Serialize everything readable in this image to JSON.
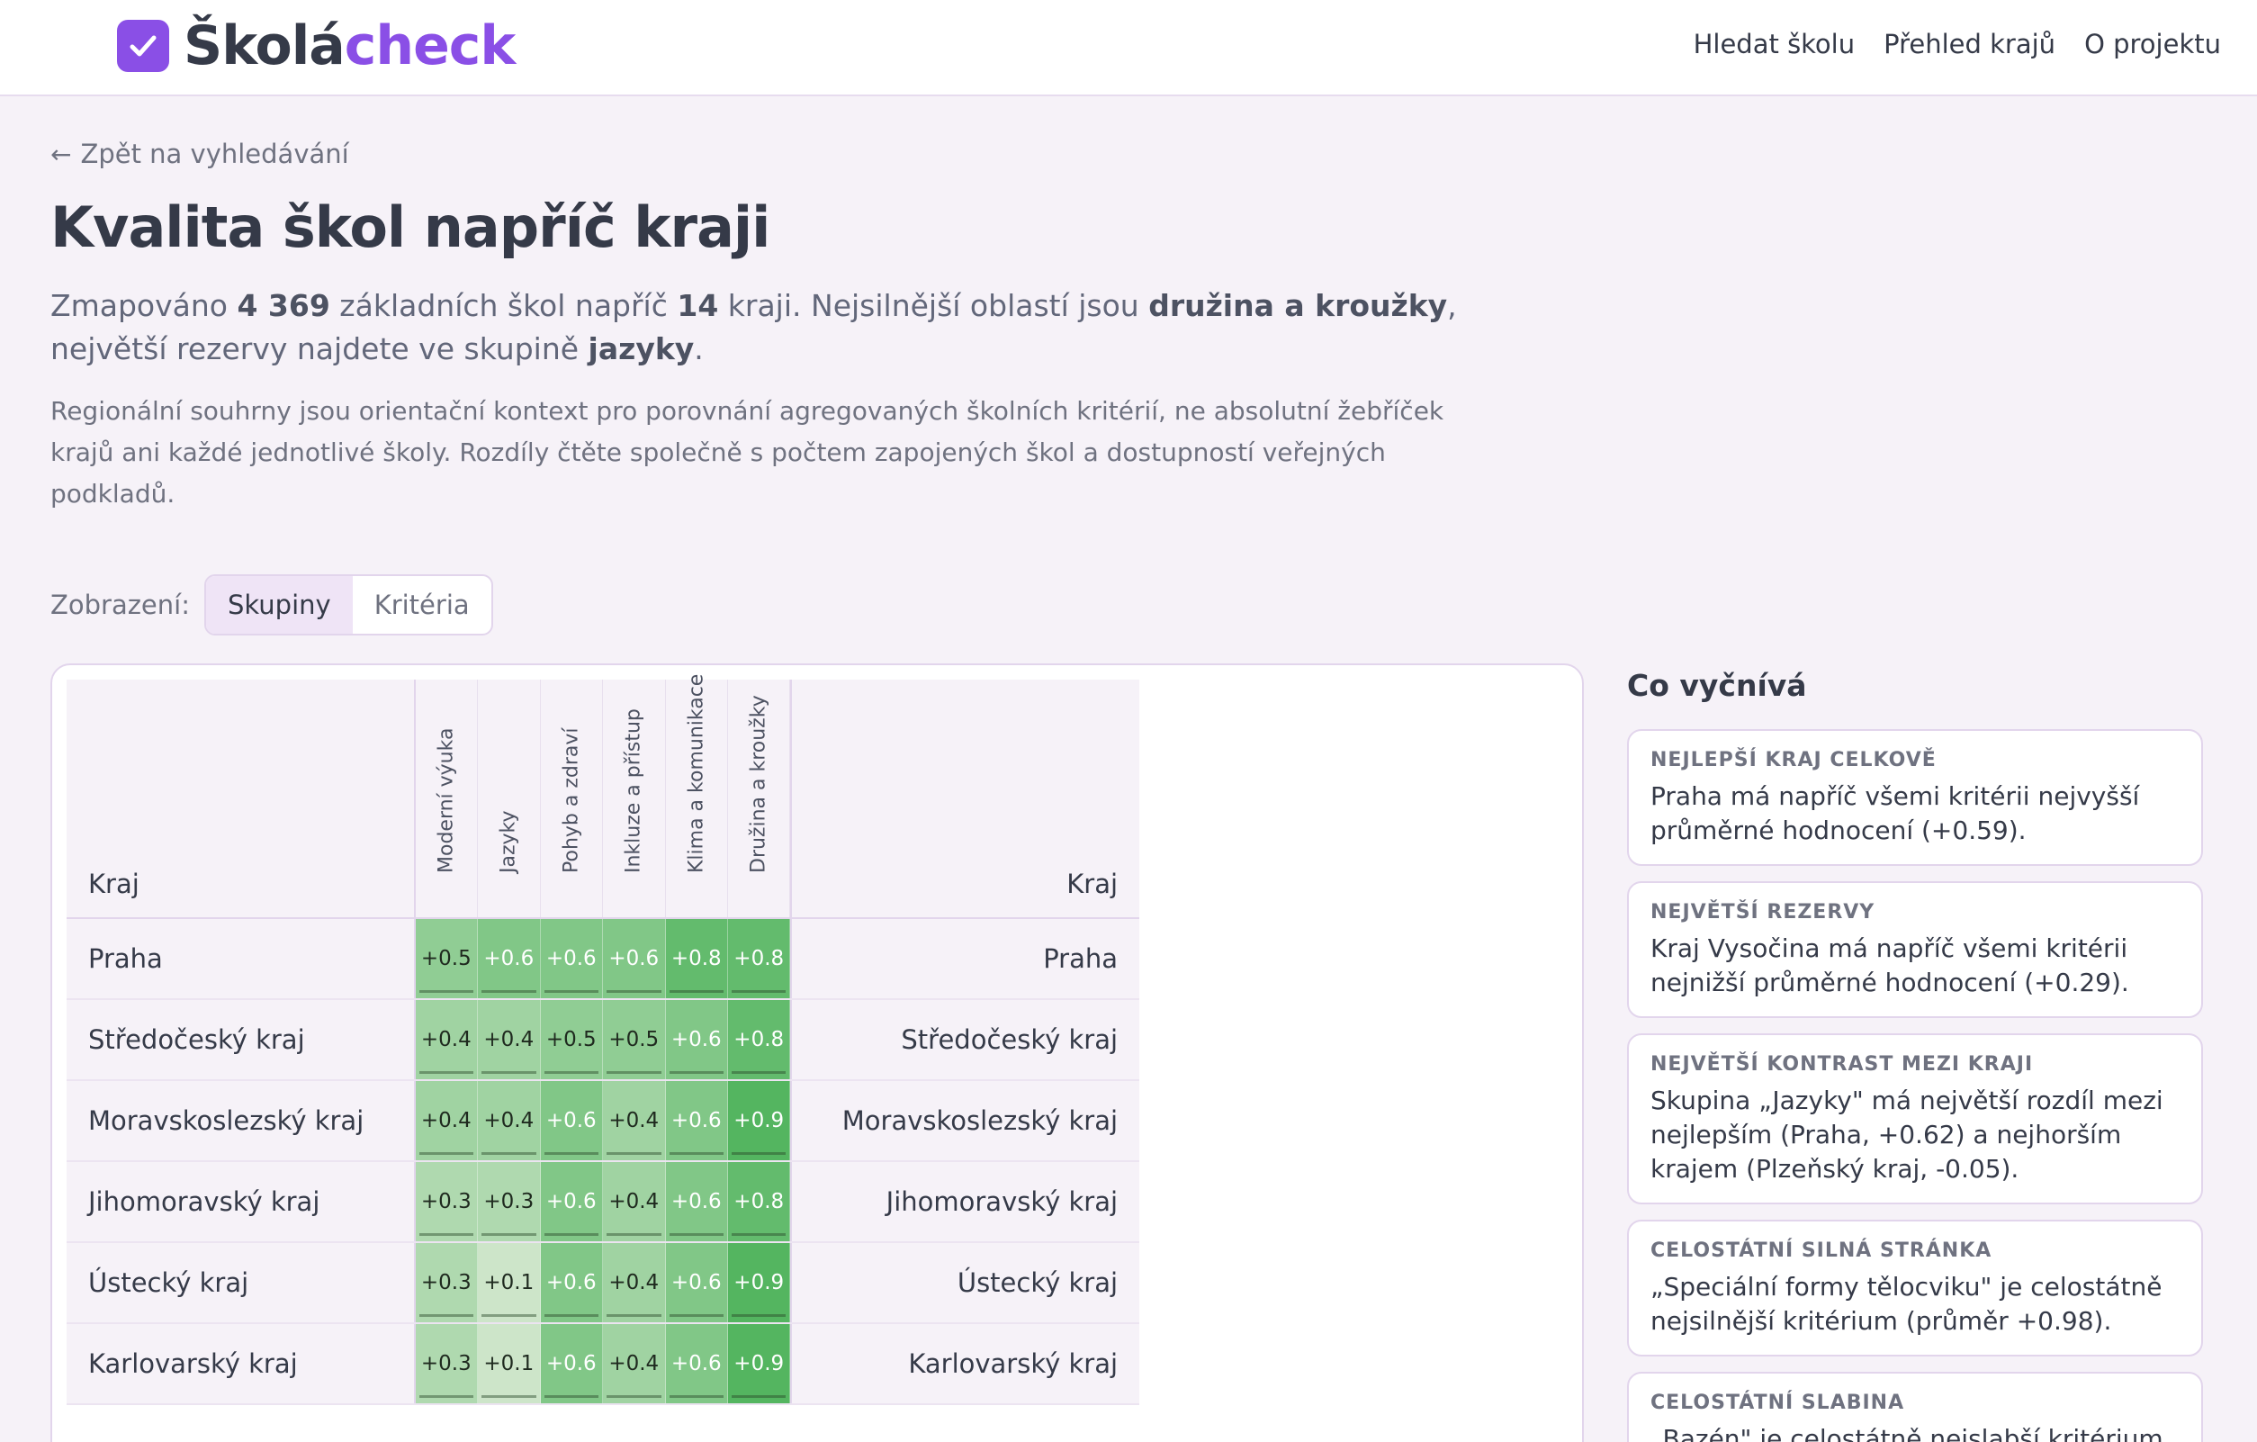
{
  "header": {
    "logo_part1": "Školá",
    "logo_part2": "check",
    "nav": [
      "Hledat školu",
      "Přehled krajů",
      "O projektu"
    ]
  },
  "back_link": "Zpět na vyhledávání",
  "title": "Kvalita škol napříč kraji",
  "lead": {
    "t1": "Zmapováno ",
    "schools": "4 369",
    "t2": " základních škol napříč ",
    "regions": "14",
    "t3": " kraji. Nejsilnější oblastí jsou ",
    "strongest": "družina a kroužky",
    "t4": ", největší rezervy najdete ve skupině ",
    "weakest": "jazyky",
    "t5": "."
  },
  "description": "Regionální souhrny jsou orientační kontext pro porovnání agregovaných školních kritérií, ne absolutní žebříček krajů ani každé jednotlivé školy. Rozdíly čtěte společně s počtem zapojených škol a dostupností veřejných podkladů.",
  "view": {
    "label": "Zobrazení:",
    "options": [
      "Skupiny",
      "Kritéria"
    ],
    "active": "Skupiny"
  },
  "table": {
    "kraj_header": "Kraj",
    "columns": [
      "Moderní výuka",
      "Jazyky",
      "Pohyb a zdraví",
      "Inkluze a přístup",
      "Klima a komunikace",
      "Družina a kroužky"
    ],
    "rows": [
      {
        "kraj": "Praha",
        "values": [
          "+0.5",
          "+0.6",
          "+0.6",
          "+0.6",
          "+0.8",
          "+0.8"
        ]
      },
      {
        "kraj": "Středočeský kraj",
        "values": [
          "+0.4",
          "+0.4",
          "+0.5",
          "+0.5",
          "+0.6",
          "+0.8"
        ]
      },
      {
        "kraj": "Moravskoslezský kraj",
        "values": [
          "+0.4",
          "+0.4",
          "+0.6",
          "+0.4",
          "+0.6",
          "+0.9"
        ]
      },
      {
        "kraj": "Jihomoravský kraj",
        "values": [
          "+0.3",
          "+0.3",
          "+0.6",
          "+0.4",
          "+0.6",
          "+0.8"
        ]
      },
      {
        "kraj": "Ústecký kraj",
        "values": [
          "+0.3",
          "+0.1",
          "+0.6",
          "+0.4",
          "+0.6",
          "+0.9"
        ]
      },
      {
        "kraj": "Karlovarský kraj",
        "values": [
          "+0.3",
          "+0.1",
          "+0.6",
          "+0.4",
          "+0.6",
          "+0.9"
        ]
      }
    ]
  },
  "sidebar": {
    "title": "Co vyčnívá",
    "insights": [
      {
        "heading": "NEJLEPŠÍ KRAJ CELKOVĚ",
        "body": "Praha má napříč všemi kritérii nejvyšší průměrné hodnocení (+0.59)."
      },
      {
        "heading": "NEJVĚTŠÍ REZERVY",
        "body": "Kraj Vysočina má napříč všemi kritérii nejnižší průměrné hodnocení (+0.29)."
      },
      {
        "heading": "NEJVĚTŠÍ KONTRAST MEZI KRAJI",
        "body": "Skupina „Jazyky\" má největší rozdíl mezi nejlepším (Praha, +0.62) a nejhorším krajem (Plzeňský kraj, -0.05)."
      },
      {
        "heading": "CELOSTÁTNÍ SILNÁ STRÁNKA",
        "body": "„Speciální formy tělocviku\" je celostátně nejsilnější kritérium (průměr +0.98)."
      },
      {
        "heading": "CELOSTÁTNÍ SLABINA",
        "body": "„Bazén\" je celostátně nejslabší kritérium"
      }
    ]
  },
  "colors": {
    "accent": "#8a4fe6",
    "heat_low": "#dcebd6",
    "heat_high": "#54b560"
  }
}
